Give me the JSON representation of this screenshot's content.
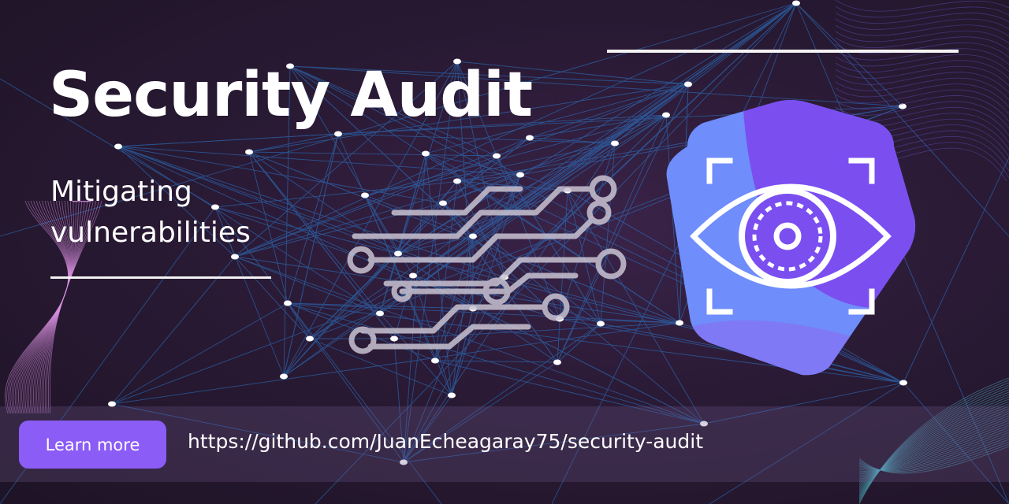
{
  "banner": {
    "title": "Security Audit",
    "subtitle": "Mitigating vulnerabilities",
    "button_label": "Learn more",
    "url": "https://github.com/JuanEcheagaray75/security-audit"
  },
  "icons": {
    "circuit": "circuit-board-icon",
    "shield": "eye-scan-shield-icon"
  },
  "colors": {
    "accent": "#8b5cf6",
    "shield_light": "#6f8dfb",
    "shield_dark": "#7b4ef0",
    "network_lines": "#2b7fd6"
  }
}
